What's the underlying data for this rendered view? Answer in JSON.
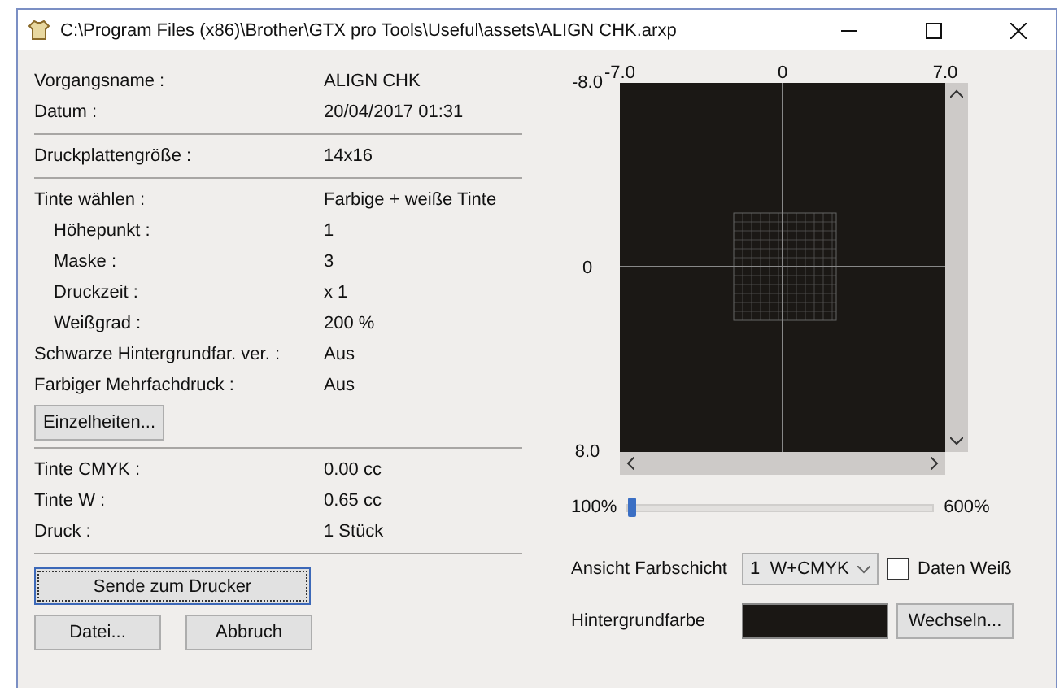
{
  "window": {
    "title": "C:\\Program Files (x86)\\Brother\\GTX pro Tools\\Useful\\assets\\ALIGN CHK.arxp"
  },
  "info_groups": [
    {
      "rows": [
        {
          "label": "Vorgangsname :",
          "value": "ALIGN CHK"
        },
        {
          "label": "Datum :",
          "value": "20/04/2017 01:31"
        }
      ]
    },
    {
      "rows": [
        {
          "label": "Druckplattengröße :",
          "value": "14x16"
        }
      ]
    },
    {
      "rows": [
        {
          "label": "Tinte wählen :",
          "value": "Farbige + weiße Tinte",
          "children": [
            {
              "label": "Höhepunkt :",
              "value": "1"
            },
            {
              "label": "Maske :",
              "value": "3"
            },
            {
              "label": "Druckzeit :",
              "value": "x 1"
            },
            {
              "label": "Weißgrad :",
              "value": "200 %"
            }
          ]
        },
        {
          "label": "Schwarze Hintergrundfar. ver. :",
          "value": "Aus"
        },
        {
          "label": "Farbiger Mehrfachdruck :",
          "value": "Aus"
        }
      ],
      "button": "Einzelheiten..."
    },
    {
      "rows": [
        {
          "label": "Tinte CMYK :",
          "value": "0.00 cc"
        },
        {
          "label": "Tinte W :",
          "value": "0.65 cc"
        },
        {
          "label": "Druck :",
          "value": "1 Stück"
        }
      ]
    }
  ],
  "send_button": "Sende zum Drucker",
  "buttons": [
    "Datei...",
    "Abbruch"
  ],
  "preview": {
    "x_labels": [
      "-7.0",
      "0",
      "7.0"
    ],
    "y_labels": [
      "-8.0",
      "0",
      "8.0"
    ]
  },
  "zoom": {
    "min_label": "100%",
    "max_label": "600%",
    "level": 0
  },
  "layer": {
    "label": "Ansicht Farbschicht",
    "value": "1  W+CMYK",
    "checkbox": {
      "label": "Daten Weiß",
      "checked": false
    }
  },
  "background": {
    "label": "Hintergrundfarbe",
    "color": "#1a1714",
    "button": "Wechseln..."
  }
}
